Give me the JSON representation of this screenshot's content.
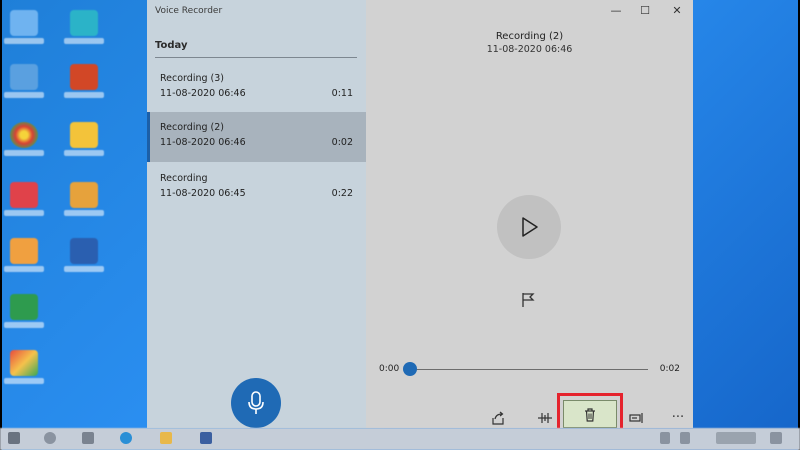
{
  "app": {
    "title": "Voice Recorder"
  },
  "sidebar": {
    "group_label": "Today",
    "recordings": [
      {
        "name": "Recording (3)",
        "date": "11-08-2020 06:46",
        "duration": "0:11",
        "selected": false
      },
      {
        "name": "Recording (2)",
        "date": "11-08-2020 06:46",
        "duration": "0:02",
        "selected": true
      },
      {
        "name": "Recording",
        "date": "11-08-2020 06:45",
        "duration": "0:22",
        "selected": false
      }
    ],
    "record_icon": "microphone-icon"
  },
  "window_controls": {
    "minimize": "—",
    "maximize": "☐",
    "close": "✕"
  },
  "player": {
    "title": "Recording (2)",
    "date": "11-08-2020 06:46",
    "current_time": "0:00",
    "total_time": "0:02",
    "progress": 0,
    "play_icon": "play-icon",
    "marker_icon": "flag-icon"
  },
  "toolbar": {
    "icons": [
      "share-icon",
      "trim-icon",
      "delete-icon",
      "rename-icon",
      "more-icon"
    ],
    "more_label": "..."
  },
  "colors": {
    "accent": "#1f6ab5",
    "sidebar_bg": "#c7d3dc",
    "selected_bg": "#a8b3bd",
    "main_bg": "#d2d2d2",
    "highlight": "#e5232d",
    "desktop": "#2a8ef0"
  }
}
